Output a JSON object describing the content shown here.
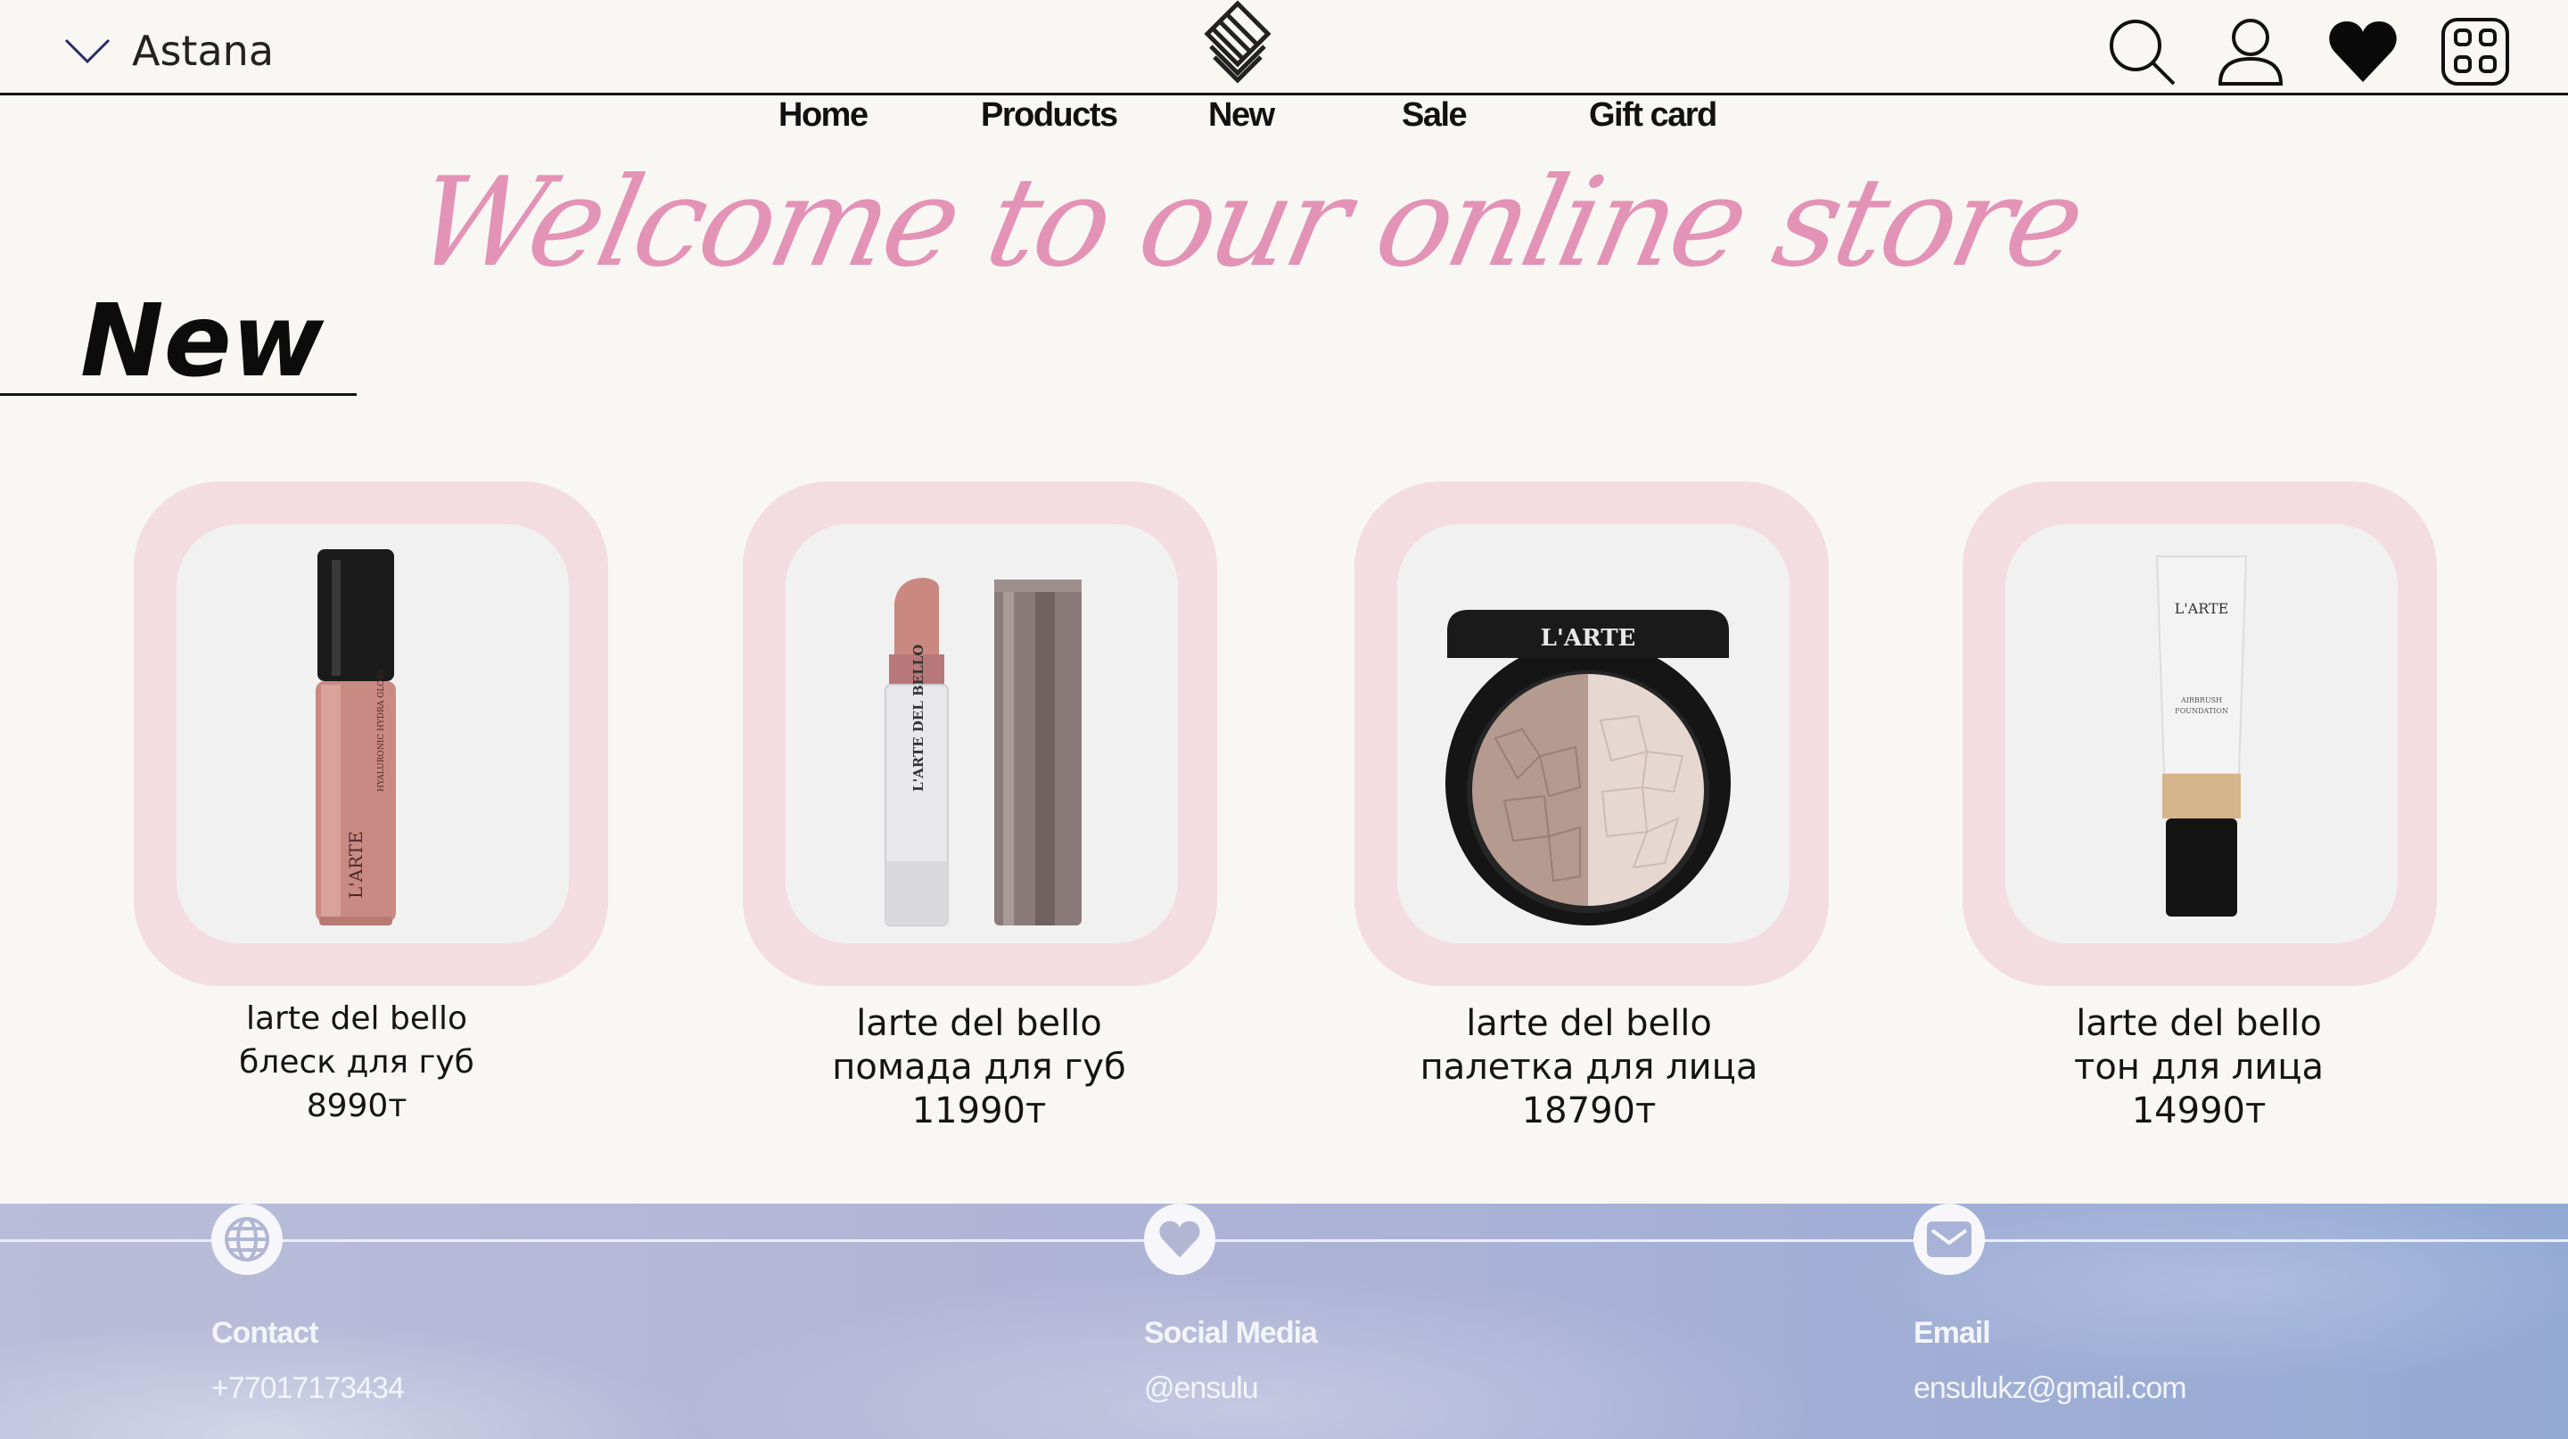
{
  "header": {
    "city": "Astana",
    "icons": [
      "search-icon",
      "user-icon",
      "heart-icon",
      "menu-grid-icon"
    ]
  },
  "nav": [
    "Home",
    "Products",
    "New",
    "Sale",
    "Gift card"
  ],
  "hero": {
    "welcome": "Welcome to our online store"
  },
  "section": {
    "title": "New"
  },
  "products": [
    {
      "brand": "larte del bello",
      "name": "блеск для губ",
      "price": "8990т"
    },
    {
      "brand": "larte del bello",
      "name": "помада для губ",
      "price": "11990т"
    },
    {
      "brand": "larte del bello",
      "name": "палетка для лица",
      "price": "18790т"
    },
    {
      "brand": "larte del bello",
      "name": "тон для лица",
      "price": "14990т"
    }
  ],
  "footer": {
    "contact": {
      "label": "Contact",
      "value": "+77017173434",
      "icon": "globe-icon"
    },
    "social": {
      "label": "Social Media",
      "value": "@ensulu",
      "icon": "heart-icon"
    },
    "email": {
      "label": "Email",
      "value": "ensulukz@gmail.com",
      "icon": "mail-icon"
    }
  },
  "colors": {
    "accent_pink": "#e393b6",
    "card_pink": "#f3dde3",
    "background": "#f9f7f3"
  }
}
